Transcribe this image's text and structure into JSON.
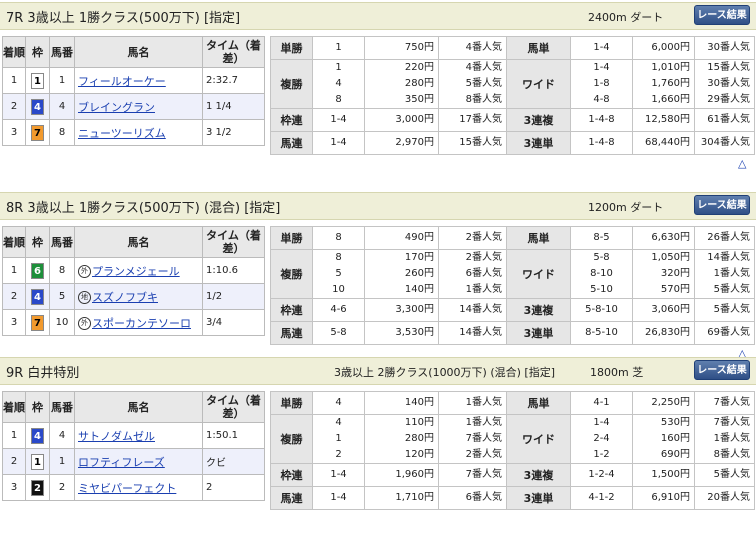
{
  "headers": {
    "finish": "着順",
    "waku": "枠",
    "umaban": "馬番",
    "horse": "馬名",
    "time": "タイム（着差）"
  },
  "pay_labels": {
    "tansho": "単勝",
    "fukusho": "複勝",
    "wakuren": "枠連",
    "umaren": "馬連",
    "umatan": "馬単",
    "wide": "ワイド",
    "sanrenpuku": "3連複",
    "sanrentan": "3連単"
  },
  "race_button": "レース結果",
  "up_icon": "△",
  "races": [
    {
      "title": "7R 3歳以上 1勝クラス(500万下) [指定]",
      "cond": "",
      "dist": "2400m ダート",
      "rows": [
        {
          "pos": "1",
          "waku": "1",
          "wc": "#ffffff",
          "wt": "#000000",
          "num": "1",
          "mark": "",
          "name": "フィールオーケー",
          "time": "2:32.7"
        },
        {
          "pos": "2",
          "waku": "4",
          "wc": "#2a49c9",
          "wt": "#ffffff",
          "num": "4",
          "mark": "",
          "name": "ブレイングラン",
          "time": "1 1/4"
        },
        {
          "pos": "3",
          "waku": "7",
          "wc": "#f29a2e",
          "wt": "#000000",
          "num": "8",
          "mark": "",
          "name": "ニューツーリズム",
          "time": "3 1/2"
        }
      ],
      "tansho": {
        "c": "1",
        "y": "750円",
        "p": "4番人気"
      },
      "fukusho": {
        "c": [
          "1",
          "4",
          "8"
        ],
        "y": [
          "220円",
          "280円",
          "350円"
        ],
        "p": [
          "4番人気",
          "5番人気",
          "8番人気"
        ]
      },
      "wakuren": {
        "c": "1-4",
        "y": "3,000円",
        "p": "17番人気"
      },
      "umaren": {
        "c": "1-4",
        "y": "2,970円",
        "p": "15番人気"
      },
      "umatan": {
        "c": "1-4",
        "y": "6,000円",
        "p": "30番人気"
      },
      "wide": {
        "c": [
          "1-4",
          "1-8",
          "4-8"
        ],
        "y": [
          "1,010円",
          "1,760円",
          "1,660円"
        ],
        "p": [
          "15番人気",
          "30番人気",
          "29番人気"
        ]
      },
      "sanrenpuku": {
        "c": "1-4-8",
        "y": "12,580円",
        "p": "61番人気"
      },
      "sanrentan": {
        "c": "1-4-8",
        "y": "68,440円",
        "p": "304番人気"
      }
    },
    {
      "title": "8R 3歳以上 1勝クラス(500万下) (混合) [指定]",
      "cond": "",
      "dist": "1200m ダート",
      "rows": [
        {
          "pos": "1",
          "waku": "6",
          "wc": "#1d8f3a",
          "wt": "#ffffff",
          "num": "8",
          "mark": "外",
          "name": "プランメジェール",
          "time": "1:10.6"
        },
        {
          "pos": "2",
          "waku": "4",
          "wc": "#2a49c9",
          "wt": "#ffffff",
          "num": "5",
          "mark": "地",
          "name": "スズノフブキ",
          "time": "1/2"
        },
        {
          "pos": "3",
          "waku": "7",
          "wc": "#f29a2e",
          "wt": "#000000",
          "num": "10",
          "mark": "外",
          "name": "スポーカンテソーロ",
          "time": "3/4"
        }
      ],
      "tansho": {
        "c": "8",
        "y": "490円",
        "p": "2番人気"
      },
      "fukusho": {
        "c": [
          "8",
          "5",
          "10"
        ],
        "y": [
          "170円",
          "260円",
          "140円"
        ],
        "p": [
          "2番人気",
          "6番人気",
          "1番人気"
        ]
      },
      "wakuren": {
        "c": "4-6",
        "y": "3,300円",
        "p": "14番人気"
      },
      "umaren": {
        "c": "5-8",
        "y": "3,530円",
        "p": "14番人気"
      },
      "umatan": {
        "c": "8-5",
        "y": "6,630円",
        "p": "26番人気"
      },
      "wide": {
        "c": [
          "5-8",
          "8-10",
          "5-10"
        ],
        "y": [
          "1,050円",
          "320円",
          "570円"
        ],
        "p": [
          "14番人気",
          "1番人気",
          "5番人気"
        ]
      },
      "sanrenpuku": {
        "c": "5-8-10",
        "y": "3,060円",
        "p": "5番人気"
      },
      "sanrentan": {
        "c": "8-5-10",
        "y": "26,830円",
        "p": "69番人気"
      }
    },
    {
      "title": "9R 白井特別",
      "cond": "3歳以上 2勝クラス(1000万下) (混合) [指定]",
      "dist": "1800m 芝",
      "rows": [
        {
          "pos": "1",
          "waku": "4",
          "wc": "#2a49c9",
          "wt": "#ffffff",
          "num": "4",
          "mark": "",
          "name": "サトノダムゼル",
          "time": "1:50.1"
        },
        {
          "pos": "2",
          "waku": "1",
          "wc": "#ffffff",
          "wt": "#000000",
          "num": "1",
          "mark": "",
          "name": "ロフティフレーズ",
          "time": "クビ"
        },
        {
          "pos": "3",
          "waku": "2",
          "wc": "#111111",
          "wt": "#ffffff",
          "num": "2",
          "mark": "",
          "name": "ミヤビパーフェクト",
          "time": "2"
        }
      ],
      "tansho": {
        "c": "4",
        "y": "140円",
        "p": "1番人気"
      },
      "fukusho": {
        "c": [
          "4",
          "1",
          "2"
        ],
        "y": [
          "110円",
          "280円",
          "120円"
        ],
        "p": [
          "1番人気",
          "7番人気",
          "2番人気"
        ]
      },
      "wakuren": {
        "c": "1-4",
        "y": "1,960円",
        "p": "7番人気"
      },
      "umaren": {
        "c": "1-4",
        "y": "1,710円",
        "p": "6番人気"
      },
      "umatan": {
        "c": "4-1",
        "y": "2,250円",
        "p": "7番人気"
      },
      "wide": {
        "c": [
          "1-4",
          "2-4",
          "1-2"
        ],
        "y": [
          "530円",
          "160円",
          "690円"
        ],
        "p": [
          "7番人気",
          "1番人気",
          "8番人気"
        ]
      },
      "sanrenpuku": {
        "c": "1-2-4",
        "y": "1,500円",
        "p": "5番人気"
      },
      "sanrentan": {
        "c": "4-1-2",
        "y": "6,910円",
        "p": "20番人気"
      }
    }
  ]
}
